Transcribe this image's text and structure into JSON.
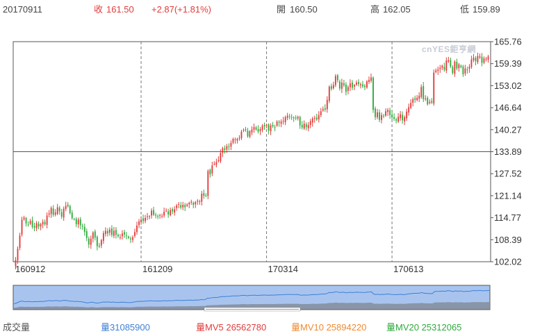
{
  "header": {
    "date": "20170911",
    "close_label": "收",
    "close_value": "161.50",
    "change": "+2.87(+1.81%)",
    "open_label": "開",
    "open_value": "160.50",
    "high_label": "高",
    "high_value": "162.05",
    "low_label": "低",
    "low_value": "159.89"
  },
  "watermark": "cnYES鉅亨網",
  "volume_bar": {
    "label": "成交量",
    "vol": "量31085900",
    "mv5": "量MV5 26562780",
    "mv10": "量MV10 25894220",
    "mv20": "量MV20 25312065"
  },
  "colors": {
    "up": "#e23b3b",
    "down": "#2eaa3c",
    "navigator_fill": "#a8c4ee",
    "navigator_line": "#3f7fd6"
  },
  "chart_data": {
    "type": "candlestick",
    "ylim": [
      102.02,
      165.76
    ],
    "y_ticks": [
      "165.76",
      "159.39",
      "153.02",
      "146.64",
      "140.27",
      "133.89",
      "127.52",
      "121.14",
      "114.77",
      "108.39",
      "102.02"
    ],
    "x_ticks": [
      {
        "label": "160912",
        "index": 0
      },
      {
        "label": "161209",
        "index": 60
      },
      {
        "label": "170314",
        "index": 120
      },
      {
        "label": "170613",
        "index": 180
      }
    ],
    "reference_line": 133.89,
    "grid": "dashed-vertical",
    "closes": [
      102.5,
      105.8,
      109.6,
      114.2,
      114.8,
      113.1,
      112.6,
      113.8,
      112.1,
      111.9,
      113.2,
      112.2,
      112.9,
      113.6,
      112.9,
      115.4,
      116.0,
      117.6,
      115.6,
      116.3,
      117.8,
      116.6,
      115.1,
      117.4,
      118.2,
      118.1,
      116.1,
      114.6,
      114.4,
      112.9,
      114.2,
      112.6,
      112.4,
      110.6,
      108.9,
      107.0,
      108.7,
      110.5,
      109.0,
      106.5,
      106.4,
      108.3,
      110.3,
      111.0,
      110.2,
      111.3,
      109.8,
      111.0,
      109.8,
      109.4,
      109.1,
      110.2,
      109.9,
      109.5,
      108.9,
      108.6,
      109.1,
      110.6,
      112.5,
      113.7,
      114.2,
      113.8,
      114.7,
      115.2,
      115.2,
      116.8,
      115.6,
      115.4,
      115.2,
      115.5,
      115.3,
      116.5,
      116.8,
      115.7,
      117.0,
      116.6,
      117.2,
      118.3,
      118.7,
      117.7,
      118.5,
      117.8,
      118.6,
      119.1,
      119.4,
      118.5,
      119.3,
      119.7,
      119.5,
      121.7,
      121.1,
      121.2,
      128.3,
      127.3,
      129.9,
      130.4,
      130.9,
      131.4,
      133.5,
      134.9,
      134.4,
      135.5,
      135.3,
      136.4,
      137.6,
      137.5,
      137.6,
      137.9,
      139.7,
      140.2,
      140.1,
      138.3,
      139.8,
      140.3,
      141.0,
      140.3,
      139.7,
      140.4,
      141.4,
      141.2,
      141.6,
      140.0,
      141.5,
      141.2,
      141.0,
      142.6,
      142.3,
      142.6,
      142.8,
      143.9,
      144.3,
      144.0,
      143.9,
      143.6,
      143.5,
      144.0,
      141.5,
      140.9,
      142.0,
      141.0,
      141.6,
      142.7,
      143.5,
      143.6,
      143.2,
      144.5,
      145.6,
      146.2,
      146.1,
      148.9,
      152.7,
      152.1,
      153.2,
      155.8,
      154.6,
      152.2,
      153.9,
      153.1,
      151.2,
      152.6,
      153.7,
      152.4,
      153.2,
      153.9,
      153.5,
      153.4,
      152.8,
      152.6,
      154.3,
      154.7,
      155.4,
      146.0,
      143.9,
      145.3,
      143.1,
      144.5,
      144.2,
      145.6,
      146.0,
      144.5,
      143.8,
      143.4,
      142.9,
      144.0,
      144.7,
      143.0,
      143.9,
      145.5,
      146.8,
      148.0,
      149.1,
      148.9,
      149.5,
      150.1,
      152.6,
      149.1,
      149.3,
      147.6,
      148.3,
      148.1,
      156.8,
      157.4,
      157.7,
      158.2,
      158.8,
      157.6,
      160.3,
      160.4,
      158.6,
      156.7,
      160.0,
      158.0,
      159.2,
      158.4,
      156.3,
      158.0,
      157.6,
      158.5,
      160.6,
      161.1,
      160.1,
      161.6,
      161.5,
      159.6,
      160.9,
      160.8,
      161.5
    ]
  }
}
